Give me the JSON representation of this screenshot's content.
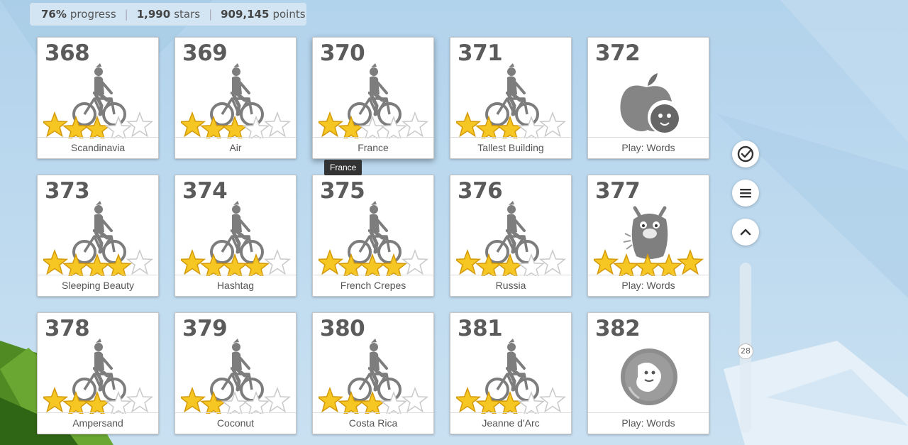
{
  "stats": {
    "progress_value": "76%",
    "progress_label": "progress",
    "stars_value": "1,990",
    "stars_label": "stars",
    "points_value": "909,145",
    "points_label": "points"
  },
  "tooltip": "France",
  "levels": [
    {
      "num": "368",
      "label": "Scandinavia",
      "type": "bike",
      "stars": 3
    },
    {
      "num": "369",
      "label": "Air",
      "type": "bike",
      "stars": 3
    },
    {
      "num": "370",
      "label": "France",
      "type": "bike",
      "stars": 2
    },
    {
      "num": "371",
      "label": "Tallest Building",
      "type": "bike",
      "stars": 3
    },
    {
      "num": "372",
      "label": "Play: Words",
      "type": "apple",
      "stars": 0
    },
    {
      "num": "373",
      "label": "Sleeping Beauty",
      "type": "bike",
      "stars": 4
    },
    {
      "num": "374",
      "label": "Hashtag",
      "type": "bike",
      "stars": 4
    },
    {
      "num": "375",
      "label": "French Crepes",
      "type": "bike",
      "stars": 4
    },
    {
      "num": "376",
      "label": "Russia",
      "type": "bike",
      "stars": 3
    },
    {
      "num": "377",
      "label": "Play: Words",
      "type": "monster",
      "stars": 5
    },
    {
      "num": "378",
      "label": "Ampersand",
      "type": "bike",
      "stars": 3
    },
    {
      "num": "379",
      "label": "Coconut",
      "type": "bike",
      "stars": 2
    },
    {
      "num": "380",
      "label": "Costa Rica",
      "type": "bike",
      "stars": 3
    },
    {
      "num": "381",
      "label": "Jeanne d'Arc",
      "type": "bike",
      "stars": 3
    },
    {
      "num": "382",
      "label": "Play: Words",
      "type": "coin",
      "stars": 0
    }
  ],
  "controls": {
    "check_icon": "check-circle-icon",
    "menu_icon": "menu-icon",
    "up_icon": "chevron-up-icon",
    "scroll_value": "28"
  },
  "colors": {
    "star_fill": "#f6c623",
    "star_empty": "#ffffff",
    "icon_gray": "#7d7d7d"
  }
}
